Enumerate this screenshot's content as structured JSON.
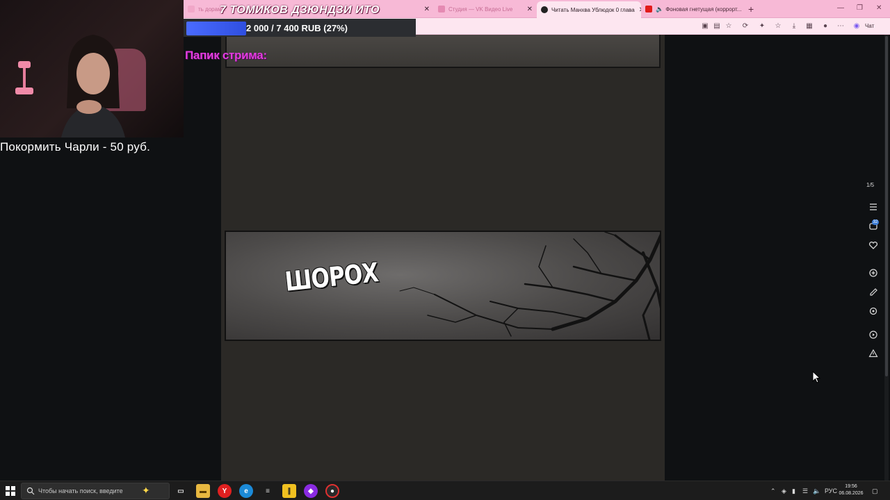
{
  "browser": {
    "tabs": [
      {
        "label": "ть дорам...",
        "active": false
      },
      {
        "label": "Студия — VK Видео Live",
        "active": false
      },
      {
        "label": "Читать Манхва Ублюдок 0 глава",
        "active": true
      },
      {
        "label": "Фоновая гнетущая (коррорт...",
        "active": false
      }
    ],
    "new_tab": "+",
    "chat_label": "Чат",
    "window_controls": [
      "—",
      "❐",
      "✕"
    ]
  },
  "overlay": {
    "title": "7 ТОМИКОВ ДЗЮНДЗИ ИТО",
    "goal_text": "2 000 / 7 400 RUB (27%)",
    "goal_fraction": 0.27,
    "papik": "Папик стрима:",
    "feed": "Покормить Чарли - 50 руб."
  },
  "reader": {
    "sound_effect": "ШОРОХ",
    "page_counter": "1/5",
    "side_icons": [
      "chapters-list-icon",
      "comments-icon",
      "favorite-heart-icon",
      "add-bookmark-icon",
      "edit-icon",
      "settings-icon",
      "play-icon",
      "report-warning-icon"
    ],
    "comments_badge": "32"
  },
  "taskbar": {
    "search_placeholder": "Чтобы начать поиск, введите",
    "tray_lang": "РУС",
    "time": "19:56",
    "date": "06.08.2026",
    "apps": [
      "task-view-icon",
      "file-explorer-icon",
      "yandex-browser-icon",
      "edge-browser-icon",
      "notes-app-icon",
      "yellow-app-icon",
      "purple-app-icon",
      "obs-icon"
    ]
  },
  "colors": {
    "tab_bar": "#f7b9d6",
    "goal_fill": "#3a5af0",
    "papik_text": "#e23de0",
    "reader_bg": "#2b2926",
    "page_bg": "#0f1113"
  }
}
